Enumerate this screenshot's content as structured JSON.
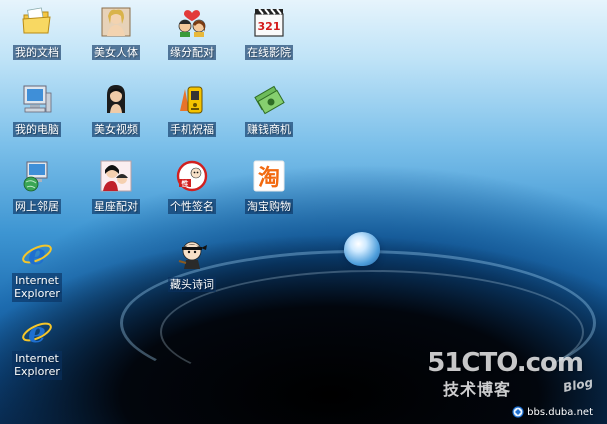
{
  "desktop": {
    "icons": [
      {
        "label": "我的文档"
      },
      {
        "label": "美女人体"
      },
      {
        "label": "缘分配对"
      },
      {
        "label": "在线影院"
      },
      {
        "label": "我的电脑"
      },
      {
        "label": "美女视频"
      },
      {
        "label": "手机祝福"
      },
      {
        "label": "赚钱商机"
      },
      {
        "label": "网上邻居"
      },
      {
        "label": "星座配对"
      },
      {
        "label": "个性签名"
      },
      {
        "label": "淘宝购物"
      },
      {
        "label": "Internet Explorer"
      },
      {
        "label": "藏头诗词"
      },
      {
        "label": "Internet Explorer"
      }
    ],
    "movie_icon_text": "321",
    "taobao_icon_text": "淘",
    "signature_icon_text": "性"
  },
  "watermark": {
    "logo": "51CTO.com",
    "subtitle": "技术博客",
    "blog": "Blog",
    "site": "bbs.duba.net"
  },
  "colors": {
    "label_bg": "#0a3060",
    "ie_blue": "#1e6fd0",
    "folder_yellow": "#f3c644"
  }
}
